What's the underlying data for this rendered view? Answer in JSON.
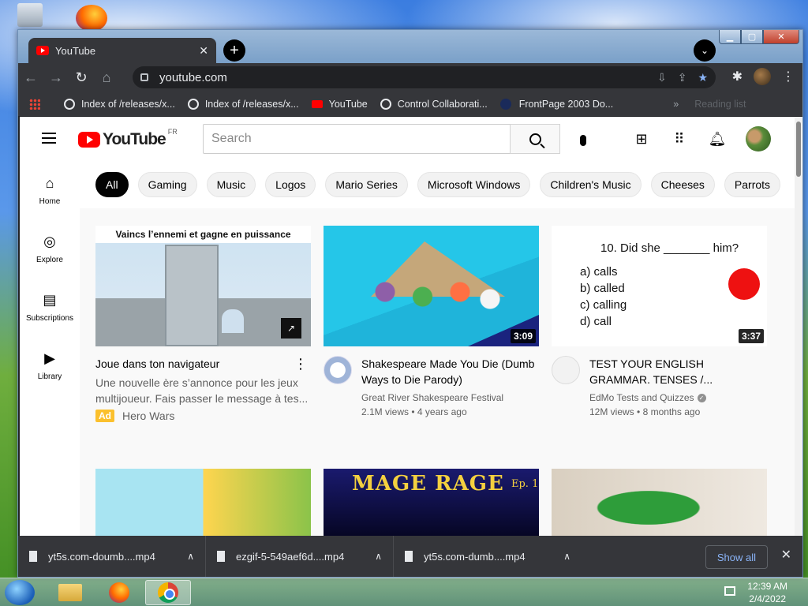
{
  "window": {
    "title": "YouTube"
  },
  "tabs": [
    {
      "label": "YouTube",
      "close": "✕"
    }
  ],
  "toolbar": {
    "url": "youtube.com"
  },
  "bookmarks": [
    {
      "label": "Index of /releases/x...",
      "icon": "globe-icon"
    },
    {
      "label": "Index of /releases/x...",
      "icon": "globe-icon"
    },
    {
      "label": "YouTube",
      "icon": "youtube-icon"
    },
    {
      "label": "Control Collaborati...",
      "icon": "globe-icon"
    },
    {
      "label": "FrontPage 2003 Do...",
      "icon": "frontpage-icon"
    }
  ],
  "bookmarks_more": "»",
  "reading_list": "Reading list",
  "youtube": {
    "logo_text": "YouTube",
    "region": "FR",
    "search_placeholder": "Search",
    "guide": [
      {
        "label": "Home",
        "icon": "home-icon"
      },
      {
        "label": "Explore",
        "icon": "compass-icon"
      },
      {
        "label": "Subscriptions",
        "icon": "subscriptions-icon"
      },
      {
        "label": "Library",
        "icon": "library-icon"
      }
    ],
    "chips": [
      "All",
      "Gaming",
      "Music",
      "Logos",
      "Mario Series",
      "Microsoft Windows",
      "Children's Music",
      "Cheeses",
      "Parrots"
    ],
    "videos": [
      {
        "title": "Joue dans ton navigateur",
        "description": "Une nouvelle ère s’annonce pour les jeux multijoueur. Fais passer le message à tes...",
        "ad_badge": "Ad",
        "advertiser": "Hero Wars",
        "thumb_text": "Vaincs l’ennemi et gagne en puissance"
      },
      {
        "title": "Shakespeare Made You Die (Dumb Ways to Die Parody)",
        "channel": "Great River Shakespeare Festival",
        "views": "2.1M views",
        "age": "4 years ago",
        "duration": "3:09"
      },
      {
        "title": "TEST YOUR ENGLISH GRAMMAR. TENSES /...",
        "channel": "EdMo Tests and Quizzes",
        "views": "12M views",
        "age": "8 months ago",
        "duration": "3:37",
        "thumb_question": "10. Did she _______ him?",
        "thumb_options": [
          "a)   calls",
          "b)   called",
          "c)    calling",
          "d)    call"
        ]
      }
    ],
    "row2_thumb_text": "MAGE RAGE",
    "row2_thumb_sub": "Ep. 1"
  },
  "downloads": [
    {
      "name": "yt5s.com-doumb....mp4"
    },
    {
      "name": "ezgif-5-549aef6d....mp4"
    },
    {
      "name": "yt5s.com-dumb....mp4"
    }
  ],
  "downloads_show_all": "Show all",
  "taskbar": {
    "time": "12:39 AM",
    "date": "2/4/2022"
  }
}
